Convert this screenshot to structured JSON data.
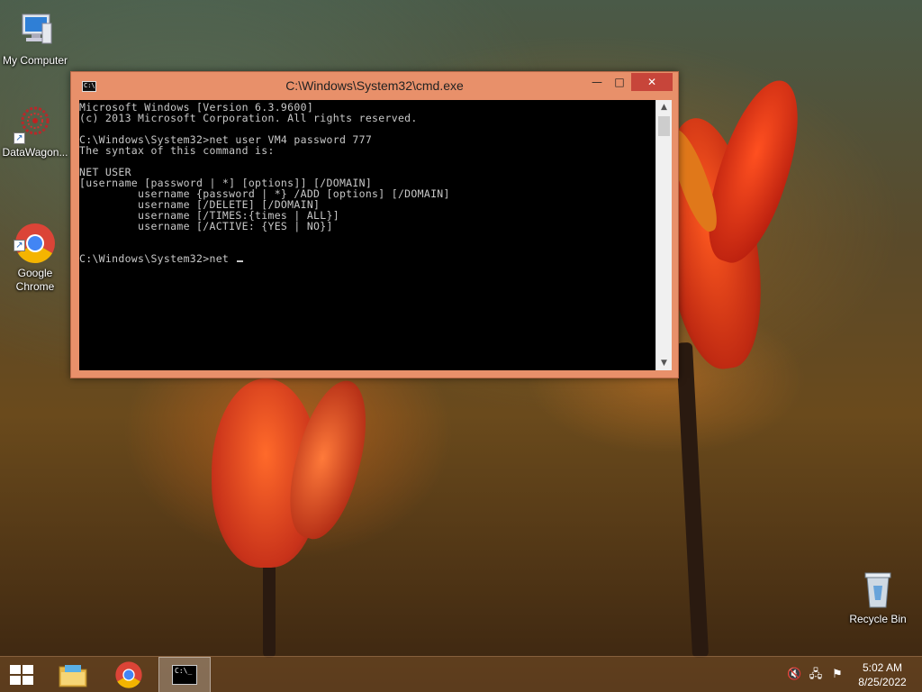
{
  "desktop": {
    "icons": [
      {
        "label": "My Computer",
        "icon": "computer-icon"
      },
      {
        "label": "DataWagon...",
        "icon": "datawagon-icon"
      },
      {
        "label": "Google\nChrome",
        "icon": "chrome-icon"
      },
      {
        "label": "Recycle Bin",
        "icon": "recycle-bin-icon"
      }
    ]
  },
  "window": {
    "title": "C:\\Windows\\System32\\cmd.exe",
    "icon_text": "C:\\",
    "minimize_glyph": "—",
    "maximize_glyph": "□",
    "close_glyph": "✕",
    "console_lines": [
      "Microsoft Windows [Version 6.3.9600]",
      "(c) 2013 Microsoft Corporation. All rights reserved.",
      "",
      "C:\\Windows\\System32>net user VM4 password 777",
      "The syntax of this command is:",
      "",
      "NET USER",
      "[username [password | *] [options]] [/DOMAIN]",
      "         username {password | *} /ADD [options] [/DOMAIN]",
      "         username [/DELETE] [/DOMAIN]",
      "         username [/TIMES:{times | ALL}]",
      "         username [/ACTIVE: {YES | NO}]",
      "",
      "",
      "C:\\Windows\\System32>net "
    ],
    "scroll_up_glyph": "▲",
    "scroll_down_glyph": "▼"
  },
  "taskbar": {
    "items": [
      "start-button",
      "file-explorer",
      "google-chrome",
      "command-prompt"
    ],
    "cmd_icon_text": "C:\\_",
    "tray": {
      "volume_glyph": "🔇",
      "network_glyph": "🖧",
      "flag_glyph": "⚑"
    },
    "clock": {
      "time": "5:02 AM",
      "date": "8/25/2022"
    }
  }
}
